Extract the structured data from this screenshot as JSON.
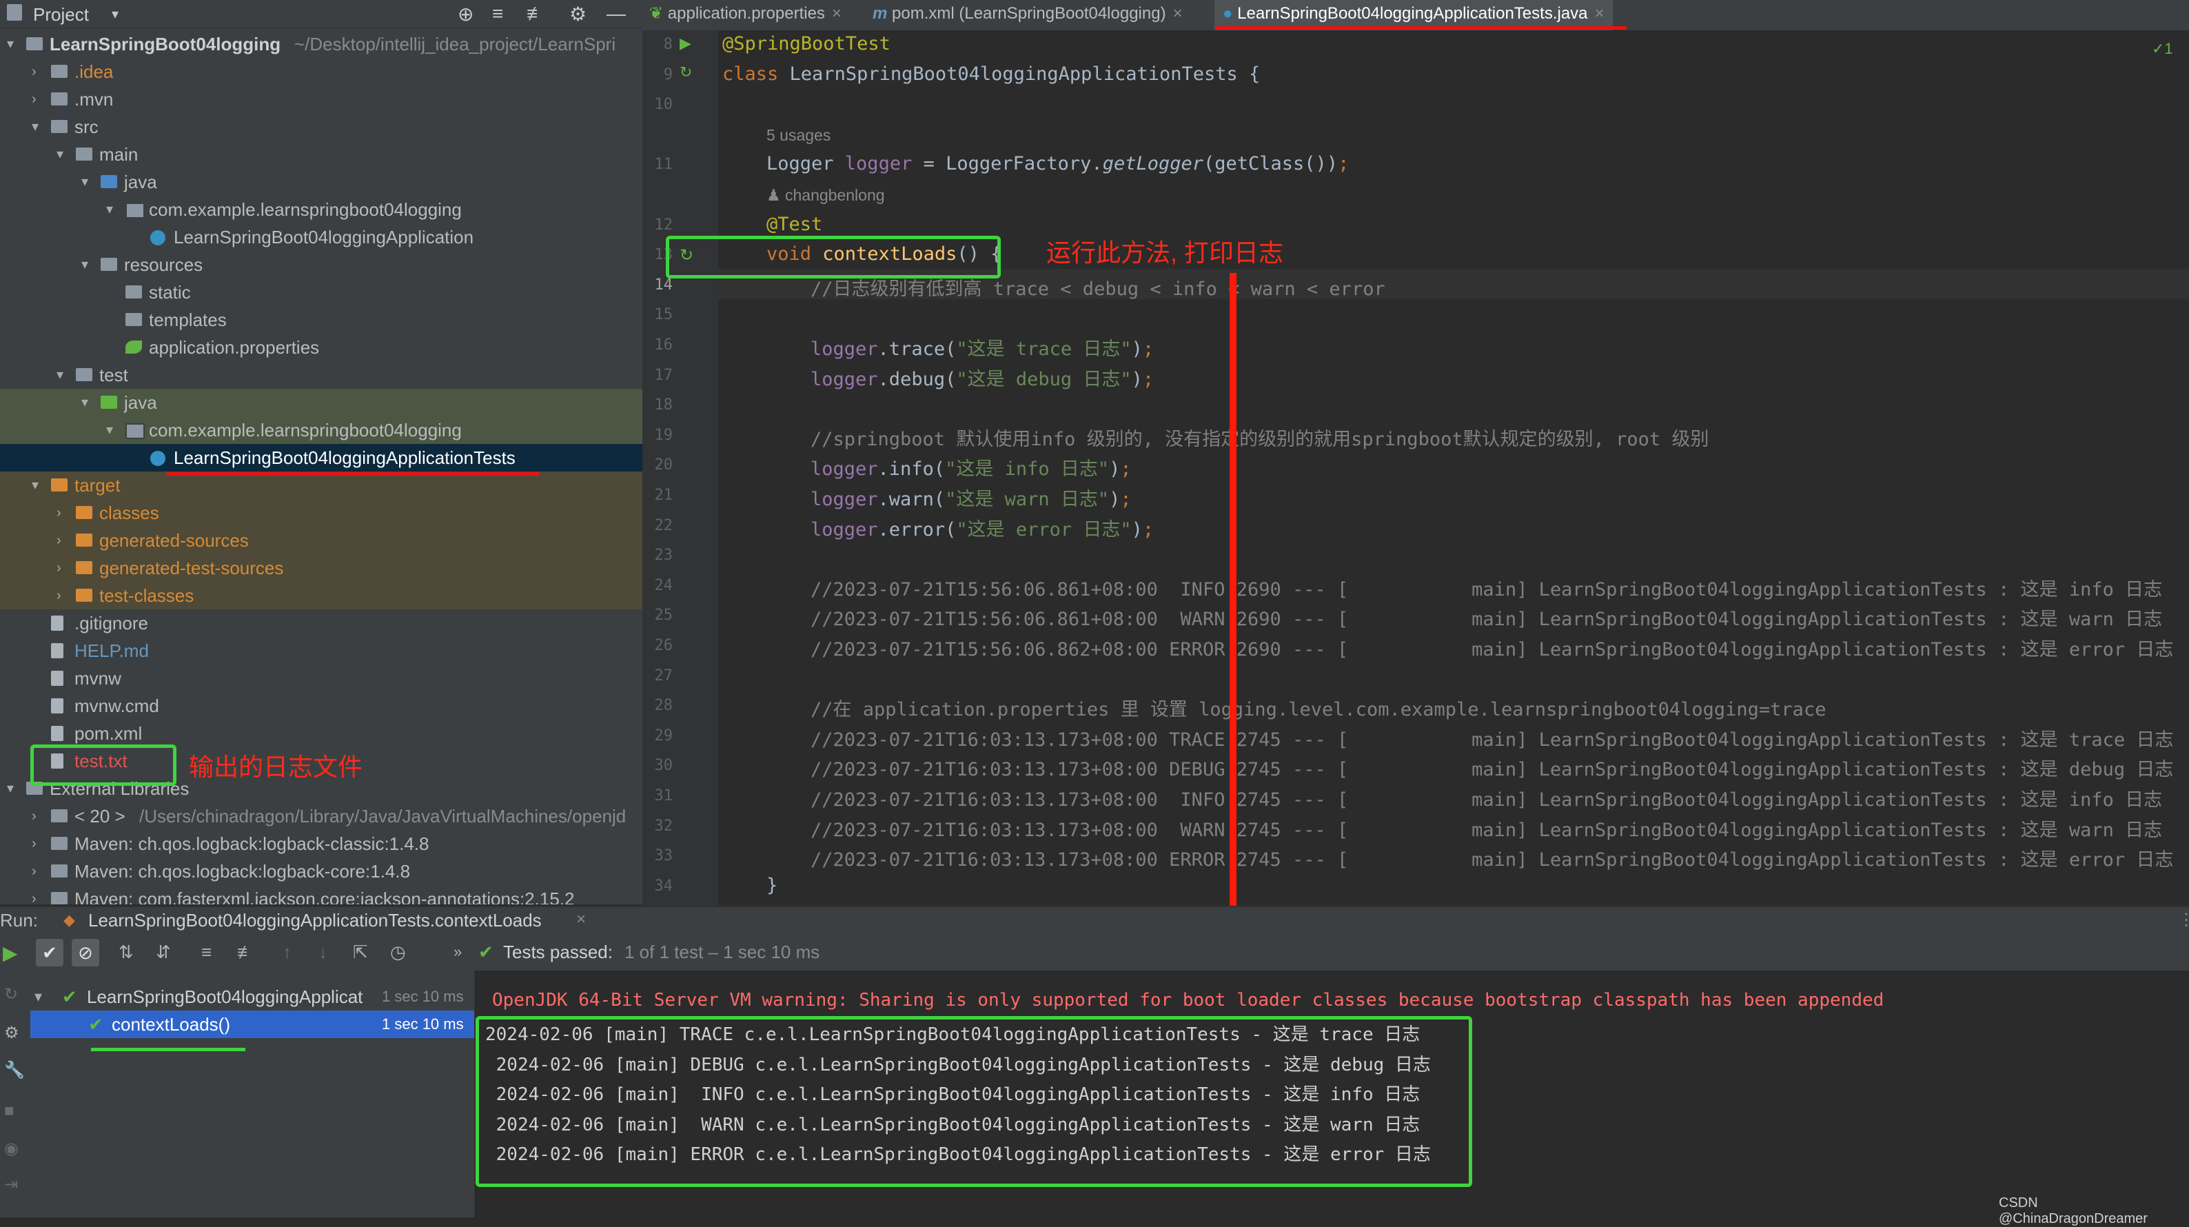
{
  "project_panel": {
    "title": "Project",
    "tree": [
      {
        "label": "LearnSpringBoot04logging",
        "extra": "~/Desktop/intellij_idea_project/LearnSpri",
        "bold": true,
        "indent": 0,
        "arrow": "▾",
        "icon": "folder",
        "color": "#d0d0d0"
      },
      {
        "label": ".idea",
        "indent": 1,
        "arrow": "›",
        "icon": "folder",
        "color": "#d88a36"
      },
      {
        "label": ".mvn",
        "indent": 1,
        "arrow": "›",
        "icon": "folder",
        "color": "#bbbbbb"
      },
      {
        "label": "src",
        "indent": 1,
        "arrow": "▾",
        "icon": "folder",
        "color": "#bbbbbb"
      },
      {
        "label": "main",
        "indent": 2,
        "arrow": "▾",
        "icon": "folder",
        "color": "#bbbbbb"
      },
      {
        "label": "java",
        "indent": 3,
        "arrow": "▾",
        "icon": "folder-blue",
        "color": "#bbbbbb"
      },
      {
        "label": "com.example.learnspringboot04logging",
        "indent": 4,
        "arrow": "▾",
        "icon": "pkg",
        "color": "#bbbbbb"
      },
      {
        "label": "LearnSpringBoot04loggingApplication",
        "indent": 5,
        "arrow": "",
        "icon": "cls",
        "color": "#bbbbbb"
      },
      {
        "label": "resources",
        "indent": 3,
        "arrow": "▾",
        "icon": "folder",
        "color": "#bbbbbb"
      },
      {
        "label": "static",
        "indent": 4,
        "arrow": "",
        "icon": "folder",
        "color": "#bbbbbb"
      },
      {
        "label": "templates",
        "indent": 4,
        "arrow": "",
        "icon": "folder",
        "color": "#bbbbbb"
      },
      {
        "label": "application.properties",
        "indent": 4,
        "arrow": "",
        "icon": "leaf-green",
        "color": "#bbbbbb"
      },
      {
        "label": "test",
        "indent": 2,
        "arrow": "▾",
        "icon": "folder",
        "color": "#bbbbbb"
      },
      {
        "label": "java",
        "indent": 3,
        "arrow": "▾",
        "icon": "folder-green",
        "color": "#bbbbbb",
        "bg": "#4b5743"
      },
      {
        "label": "com.example.learnspringboot04logging",
        "indent": 4,
        "arrow": "▾",
        "icon": "pkg",
        "color": "#bbbbbb",
        "bg": "#4b5743"
      },
      {
        "label": "LearnSpringBoot04loggingApplicationTests",
        "indent": 5,
        "arrow": "",
        "icon": "cls",
        "color": "#ffffff",
        "bg": "#0d293e"
      },
      {
        "label": "target",
        "indent": 1,
        "arrow": "▾",
        "icon": "folder-orange",
        "color": "#d88a36",
        "bg": "#4e4a37"
      },
      {
        "label": "classes",
        "indent": 2,
        "arrow": "›",
        "icon": "folder-orange",
        "color": "#d88a36",
        "bg": "#4e4a37"
      },
      {
        "label": "generated-sources",
        "indent": 2,
        "arrow": "›",
        "icon": "folder-orange",
        "color": "#d88a36",
        "bg": "#4e4a37"
      },
      {
        "label": "generated-test-sources",
        "indent": 2,
        "arrow": "›",
        "icon": "folder-orange",
        "color": "#d88a36",
        "bg": "#4e4a37"
      },
      {
        "label": "test-classes",
        "indent": 2,
        "arrow": "›",
        "icon": "folder-orange",
        "color": "#d88a36",
        "bg": "#4e4a37"
      },
      {
        "label": ".gitignore",
        "indent": 1,
        "arrow": "",
        "icon": "file",
        "color": "#bbbbbb"
      },
      {
        "label": "HELP.md",
        "indent": 1,
        "arrow": "",
        "icon": "file",
        "color": "#6897bb"
      },
      {
        "label": "mvnw",
        "indent": 1,
        "arrow": "",
        "icon": "file",
        "color": "#bbbbbb"
      },
      {
        "label": "mvnw.cmd",
        "indent": 1,
        "arrow": "",
        "icon": "file",
        "color": "#bbbbbb"
      },
      {
        "label": "pom.xml",
        "indent": 1,
        "arrow": "",
        "icon": "file",
        "color": "#bbbbbb"
      },
      {
        "label": "test.txt",
        "indent": 1,
        "arrow": "",
        "icon": "file",
        "color": "#e05555"
      },
      {
        "label": "External Libraries",
        "indent": 0,
        "arrow": "▾",
        "icon": "folder",
        "color": "#bbbbbb"
      },
      {
        "label": "< 20 >",
        "extra": "/Users/chinadragon/Library/Java/JavaVirtualMachines/openjd",
        "indent": 1,
        "arrow": "›",
        "icon": "folder",
        "color": "#bbbbbb"
      },
      {
        "label": "Maven: ch.qos.logback:logback-classic:1.4.8",
        "indent": 1,
        "arrow": "›",
        "icon": "folder",
        "color": "#bbbbbb"
      },
      {
        "label": "Maven: ch.qos.logback:logback-core:1.4.8",
        "indent": 1,
        "arrow": "›",
        "icon": "folder",
        "color": "#bbbbbb"
      },
      {
        "label": "Maven: com.fasterxml.jackson.core:jackson-annotations:2.15.2",
        "indent": 1,
        "arrow": "›",
        "icon": "folder",
        "color": "#bbbbbb"
      }
    ]
  },
  "tabs": [
    {
      "label": "application.properties",
      "active": false
    },
    {
      "label": "pom.xml (LearnSpringBoot04logging)",
      "active": false
    },
    {
      "label": "LearnSpringBoot04loggingApplicationTests.java",
      "active": true
    }
  ],
  "editor": {
    "check_badge": "✓1",
    "lines": [
      {
        "n": "8",
        "segs": [
          [
            "ann",
            "@SpringBootTest"
          ]
        ],
        "indent": 0
      },
      {
        "n": "9",
        "segs": [
          [
            "kw",
            "class "
          ],
          [
            "",
            "LearnSpringBoot04loggingApplicationTests {"
          ]
        ],
        "indent": 0
      },
      {
        "n": "10",
        "segs": [],
        "indent": 0
      },
      {
        "hint": "5 usages",
        "indent": 1
      },
      {
        "n": "11",
        "segs": [
          [
            "",
            "Logger "
          ],
          [
            "fld",
            "logger"
          ],
          [
            "",
            " = LoggerFactory."
          ],
          [
            "it",
            "getLogger"
          ],
          [
            "",
            "(getClass())"
          ],
          [
            "kw",
            ";"
          ]
        ],
        "indent": 1
      },
      {
        "hint": "♟ changbenlong",
        "indent": 1
      },
      {
        "n": "12",
        "segs": [
          [
            "ann",
            "@Test"
          ]
        ],
        "indent": 1
      },
      {
        "n": "13",
        "segs": [
          [
            "kw",
            "void "
          ],
          [
            "fn",
            "contextLoads"
          ],
          [
            "",
            "() {"
          ]
        ],
        "indent": 1
      },
      {
        "n": "14",
        "segs": [
          [
            "cm",
            "//日志级别有低到高 trace < debug < info < warn < error"
          ]
        ],
        "indent": 2
      },
      {
        "n": "15",
        "segs": [],
        "indent": 0
      },
      {
        "n": "16",
        "segs": [
          [
            "fld",
            "logger"
          ],
          [
            "",
            ".trace("
          ],
          [
            "str",
            "\"这是 trace 日志\""
          ],
          [
            "",
            ")"
          ],
          [
            "kw",
            ";"
          ]
        ],
        "indent": 2
      },
      {
        "n": "17",
        "segs": [
          [
            "fld",
            "logger"
          ],
          [
            "",
            ".debug("
          ],
          [
            "str",
            "\"这是 debug 日志\""
          ],
          [
            "",
            ")"
          ],
          [
            "kw",
            ";"
          ]
        ],
        "indent": 2
      },
      {
        "n": "18",
        "segs": [],
        "indent": 0
      },
      {
        "n": "19",
        "segs": [
          [
            "cm",
            "//springboot 默认使用info 级别的, 没有指定的级别的就用springboot默认规定的级别, root 级别"
          ]
        ],
        "indent": 2
      },
      {
        "n": "20",
        "segs": [
          [
            "fld",
            "logger"
          ],
          [
            "",
            ".info("
          ],
          [
            "str",
            "\"这是 info 日志\""
          ],
          [
            "",
            ")"
          ],
          [
            "kw",
            ";"
          ]
        ],
        "indent": 2
      },
      {
        "n": "21",
        "segs": [
          [
            "fld",
            "logger"
          ],
          [
            "",
            ".warn("
          ],
          [
            "str",
            "\"这是 warn 日志\""
          ],
          [
            "",
            ")"
          ],
          [
            "kw",
            ";"
          ]
        ],
        "indent": 2
      },
      {
        "n": "22",
        "segs": [
          [
            "fld",
            "logger"
          ],
          [
            "",
            ".error("
          ],
          [
            "str",
            "\"这是 error 日志\""
          ],
          [
            "",
            ")"
          ],
          [
            "kw",
            ";"
          ]
        ],
        "indent": 2
      },
      {
        "n": "23",
        "segs": [],
        "indent": 0
      },
      {
        "n": "24",
        "segs": [
          [
            "cm",
            "//2023-07-21T15:56:06.861+08:00  INFO 2690 --- [           main] LearnSpringBoot04loggingApplicationTests : 这是 info 日志"
          ]
        ],
        "indent": 2
      },
      {
        "n": "25",
        "segs": [
          [
            "cm",
            "//2023-07-21T15:56:06.861+08:00  WARN 2690 --- [           main] LearnSpringBoot04loggingApplicationTests : 这是 warn 日志"
          ]
        ],
        "indent": 2
      },
      {
        "n": "26",
        "segs": [
          [
            "cm",
            "//2023-07-21T15:56:06.862+08:00 ERROR 2690 --- [           main] LearnSpringBoot04loggingApplicationTests : 这是 error 日志"
          ]
        ],
        "indent": 2
      },
      {
        "n": "27",
        "segs": [],
        "indent": 0
      },
      {
        "n": "28",
        "segs": [
          [
            "cm",
            "//在 application.properties 里 设置 logging.level.com.example.learnspringboot04logging=trace"
          ]
        ],
        "indent": 2
      },
      {
        "n": "29",
        "segs": [
          [
            "cm",
            "//2023-07-21T16:03:13.173+08:00 TRACE 2745 --- [           main] LearnSpringBoot04loggingApplicationTests : 这是 trace 日志"
          ]
        ],
        "indent": 2
      },
      {
        "n": "30",
        "segs": [
          [
            "cm",
            "//2023-07-21T16:03:13.173+08:00 DEBUG 2745 --- [           main] LearnSpringBoot04loggingApplicationTests : 这是 debug 日志"
          ]
        ],
        "indent": 2
      },
      {
        "n": "31",
        "segs": [
          [
            "cm",
            "//2023-07-21T16:03:13.173+08:00  INFO 2745 --- [           main] LearnSpringBoot04loggingApplicationTests : 这是 info 日志"
          ]
        ],
        "indent": 2
      },
      {
        "n": "32",
        "segs": [
          [
            "cm",
            "//2023-07-21T16:03:13.173+08:00  WARN 2745 --- [           main] LearnSpringBoot04loggingApplicationTests : 这是 warn 日志"
          ]
        ],
        "indent": 2
      },
      {
        "n": "33",
        "segs": [
          [
            "cm",
            "//2023-07-21T16:03:13.173+08:00 ERROR 2745 --- [           main] LearnSpringBoot04loggingApplicationTests : 这是 error 日志"
          ]
        ],
        "indent": 2
      },
      {
        "n": "34",
        "segs": [
          [
            "",
            "}"
          ]
        ],
        "indent": 1
      }
    ]
  },
  "annotations": {
    "run_method_note": "运行此方法, 打印日志",
    "output_file_note": "输出的日志文件"
  },
  "run": {
    "label": "Run:",
    "config": "LearnSpringBoot04loggingApplicationTests.contextLoads",
    "status_passed": "Tests passed:",
    "status_detail": "1 of 1 test – 1 sec 10 ms",
    "tree": [
      {
        "label": "LearnSpringBoot04loggingApplicat",
        "time": "1 sec 10 ms",
        "selected": false
      },
      {
        "label": "contextLoads()",
        "time": "1 sec 10 ms",
        "selected": true
      }
    ],
    "console_warning": "OpenJDK 64-Bit Server VM warning: Sharing is only supported for boot loader classes because bootstrap classpath has been appended",
    "console_lines": [
      "2024-02-06 [main] TRACE c.e.l.LearnSpringBoot04loggingApplicationTests - 这是 trace 日志",
      " 2024-02-06 [main] DEBUG c.e.l.LearnSpringBoot04loggingApplicationTests - 这是 debug 日志",
      " 2024-02-06 [main]  INFO c.e.l.LearnSpringBoot04loggingApplicationTests - 这是 info 日志",
      " 2024-02-06 [main]  WARN c.e.l.LearnSpringBoot04loggingApplicationTests - 这是 warn 日志",
      " 2024-02-06 [main] ERROR c.e.l.LearnSpringBoot04loggingApplicationTests - 这是 error 日志"
    ],
    "watermark": "CSDN @ChinaDragonDreamer"
  },
  "colors": {
    "highlight_box": "#3fd43f",
    "annotation_red": "#ff2a1a",
    "console_warning": "#ff6b68",
    "selection_blue": "#2f65ca"
  }
}
